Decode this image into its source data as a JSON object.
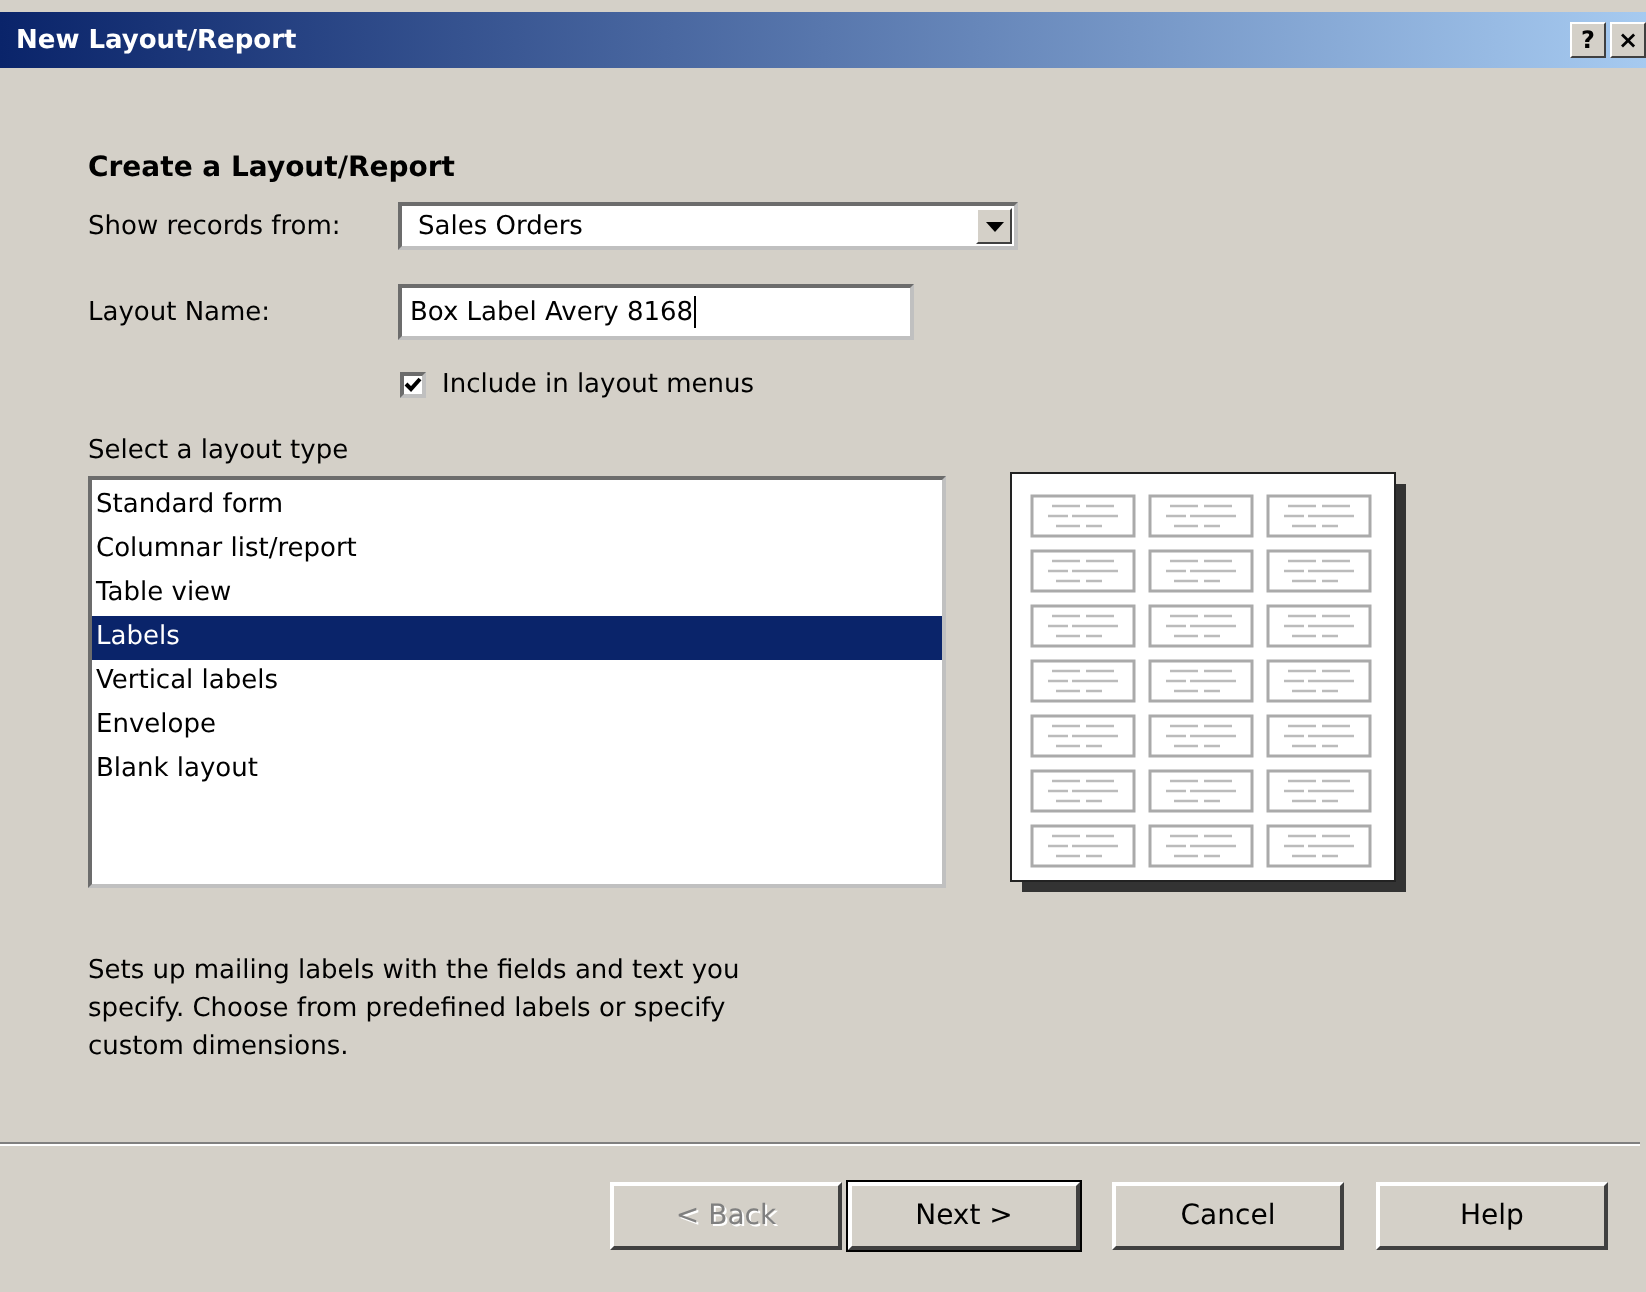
{
  "window": {
    "title": "New Layout/Report",
    "help_button": "?",
    "close_button": "×"
  },
  "heading": "Create a Layout/Report",
  "source": {
    "label": "Show records from:",
    "value": "Sales Orders"
  },
  "layout_name": {
    "label": "Layout Name:",
    "value": "Box Label Avery 8168"
  },
  "include_in_menus": {
    "label": "Include in layout menus",
    "checked": true
  },
  "layout_type": {
    "label": "Select a layout type",
    "items": [
      {
        "label": "Standard form",
        "selected": false
      },
      {
        "label": "Columnar list/report",
        "selected": false
      },
      {
        "label": "Table view",
        "selected": false
      },
      {
        "label": "Labels",
        "selected": true
      },
      {
        "label": "Vertical labels",
        "selected": false
      },
      {
        "label": "Envelope",
        "selected": false
      },
      {
        "label": "Blank layout",
        "selected": false
      }
    ]
  },
  "description": "Sets up mailing labels with the fields and text you specify.  Choose from predefined labels or specify custom dimensions.",
  "buttons": [
    {
      "label": "< Back",
      "disabled": true,
      "default": false
    },
    {
      "label": "Next >",
      "disabled": false,
      "default": true
    },
    {
      "label": "Cancel",
      "disabled": false,
      "default": false
    },
    {
      "label": "Help",
      "disabled": false,
      "default": false
    }
  ]
}
